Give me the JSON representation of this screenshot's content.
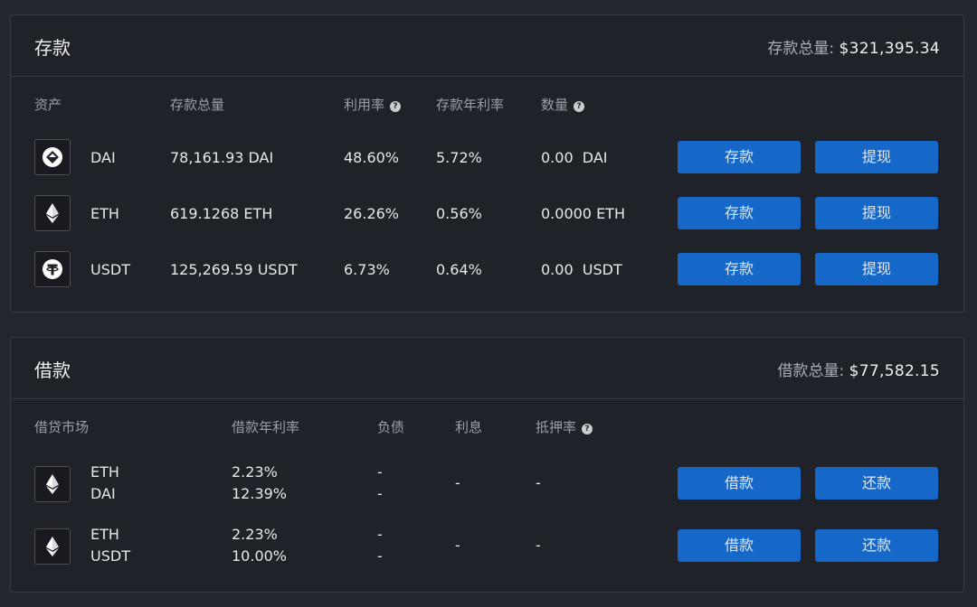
{
  "deposit": {
    "title": "存款",
    "total_label": "存款总量:",
    "total_value": "$321,395.34",
    "columns": {
      "asset": "资产",
      "total": "存款总量",
      "utilization": "利用率",
      "apy": "存款年利率",
      "amount": "数量"
    },
    "rows": [
      {
        "icon": "dai-icon",
        "asset": "DAI",
        "total": "78,161.93 DAI",
        "utilization": "48.60%",
        "apy": "5.72%",
        "amount": "0.00  DAI",
        "deposit_label": "存款",
        "withdraw_label": "提现"
      },
      {
        "icon": "eth-icon",
        "asset": "ETH",
        "total": "619.1268 ETH",
        "utilization": "26.26%",
        "apy": "0.56%",
        "amount": "0.0000 ETH",
        "deposit_label": "存款",
        "withdraw_label": "提现"
      },
      {
        "icon": "usdt-icon",
        "asset": "USDT",
        "total": "125,269.59 USDT",
        "utilization": "6.73%",
        "apy": "0.64%",
        "amount": "0.00  USDT",
        "deposit_label": "存款",
        "withdraw_label": "提现"
      }
    ]
  },
  "borrow": {
    "title": "借款",
    "total_label": "借款总量:",
    "total_value": "$77,582.15",
    "columns": {
      "market": "借贷市场",
      "apr": "借款年利率",
      "debt": "负债",
      "interest": "利息",
      "collateral_ratio": "抵押率"
    },
    "rows": [
      {
        "icon": "eth-icon",
        "asset_a": "ETH",
        "asset_b": "DAI",
        "apr_a": "2.23%",
        "apr_b": "12.39%",
        "debt_a": "-",
        "debt_b": "-",
        "interest": "-",
        "collateral_ratio": "-",
        "borrow_label": "借款",
        "repay_label": "还款"
      },
      {
        "icon": "eth-icon",
        "asset_a": "ETH",
        "asset_b": "USDT",
        "apr_a": "2.23%",
        "apr_b": "10.00%",
        "debt_a": "-",
        "debt_b": "-",
        "interest": "-",
        "collateral_ratio": "-",
        "borrow_label": "借款",
        "repay_label": "还款"
      }
    ]
  },
  "colors": {
    "background": "#23262d",
    "panel": "#1f2229",
    "border": "#363a43",
    "button": "#1668c8"
  }
}
